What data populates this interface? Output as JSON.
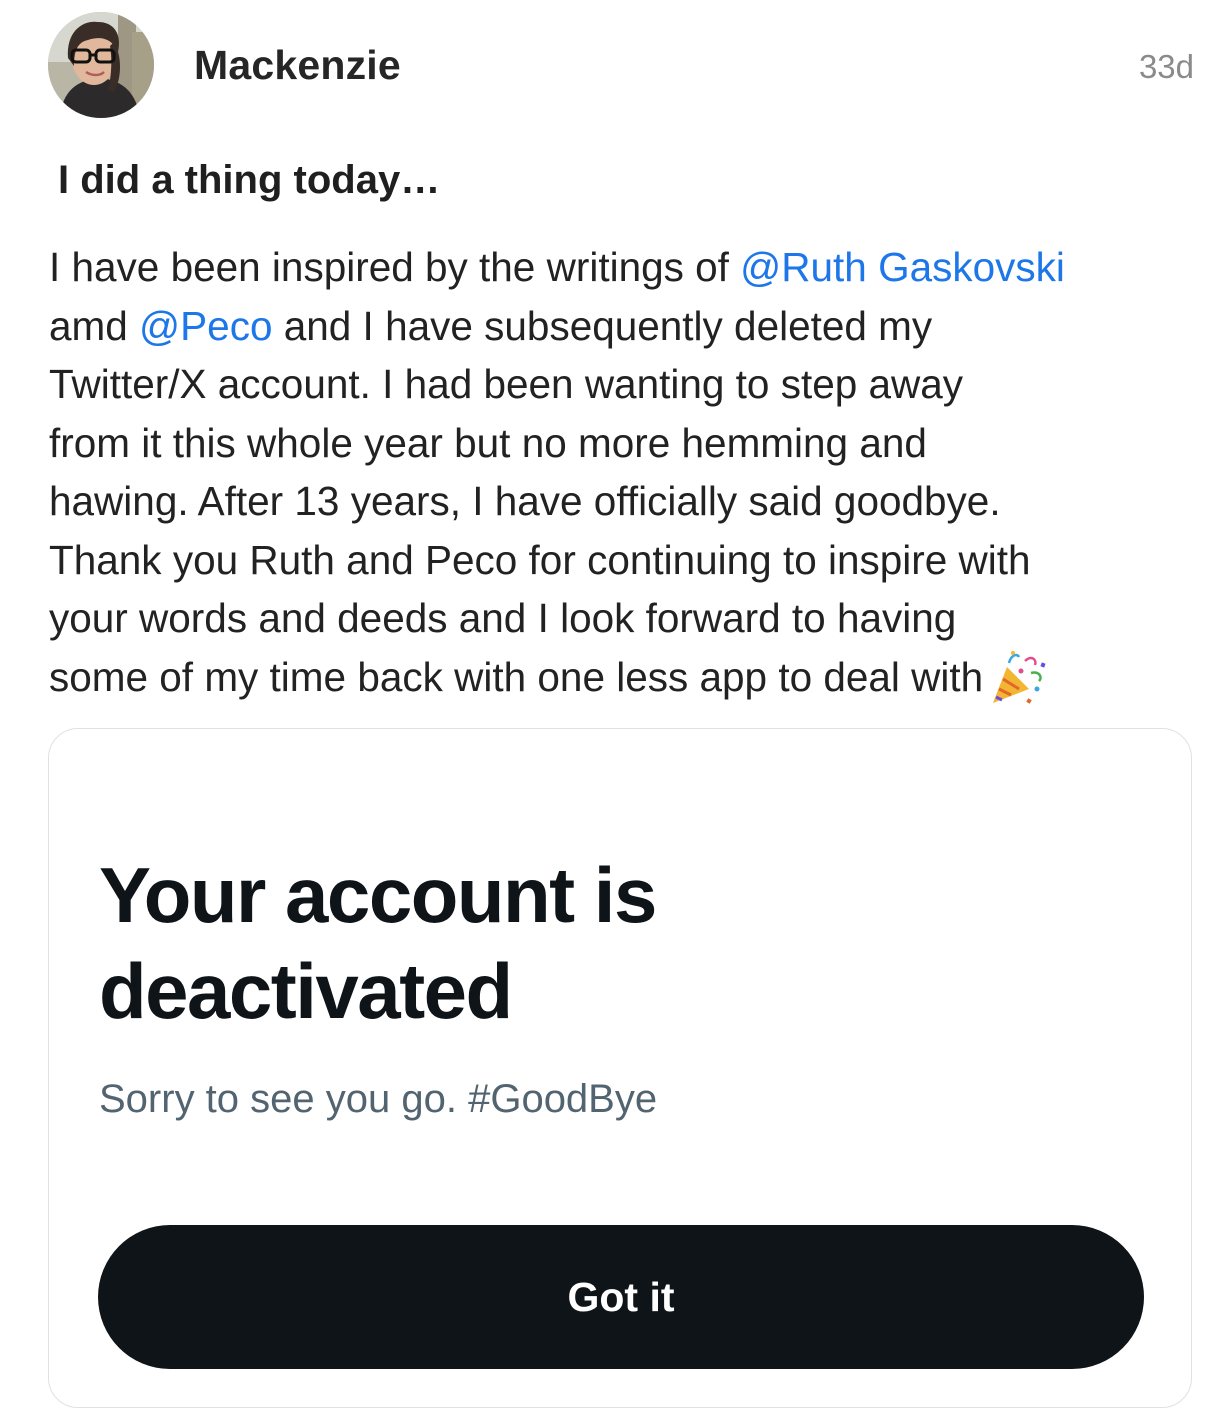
{
  "post": {
    "author": "Mackenzie",
    "time": "33d",
    "avatar_icon": "profile-photo",
    "title": "I did a thing today…",
    "body": {
      "line1_pre": "I have been inspired by the writings of ",
      "mention1": "@Ruth Gaskovski",
      "line2_pre": "amd ",
      "mention2": "@Peco",
      "line2_post": " and I have subsequently deleted my",
      "line3": "Twitter/X account. I had been wanting to step away",
      "line4": "from it this whole year but no more hemming and",
      "line5": "hawing. After 13 years, I have officially said goodbye.",
      "line6": "Thank you Ruth and Peco for continuing to inspire with",
      "line7": "your words and deeds and I look forward to having",
      "line8": "some of my time back with one less app to deal with",
      "emoji_icon": "party-popper-emoji"
    },
    "mention_color": "#1d77e8"
  },
  "embed": {
    "heading_line1": "Your account is",
    "heading_line2": "deactivated",
    "subtitle": "Sorry to see you go. #GoodBye",
    "button_label": "Got it",
    "button_color": "#0f1419"
  }
}
